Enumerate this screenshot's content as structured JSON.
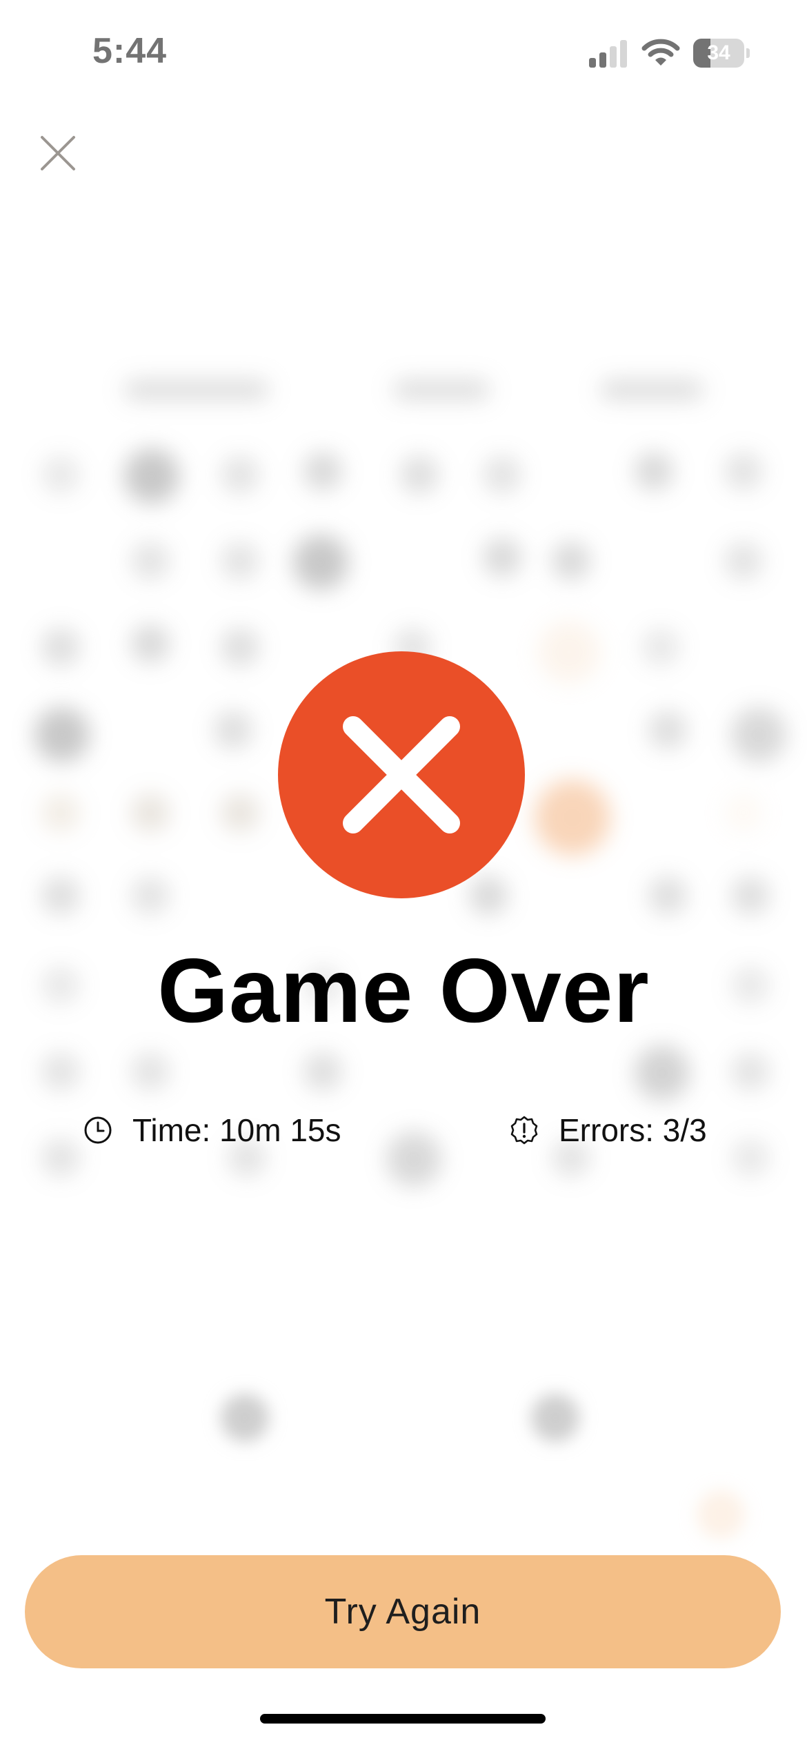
{
  "status_bar": {
    "time": "5:44",
    "battery": "34",
    "battery_level": 0.34
  },
  "game_over": {
    "title": "Game Over",
    "time_label": "Time: 10m 15s",
    "errors_label": "Errors: 3/3"
  },
  "actions": {
    "try_again": "Try Again"
  },
  "colors": {
    "accent_red": "#ea4f28",
    "button_orange": "#f4bf87",
    "highlight_orange": "#f2a66a"
  },
  "icons": {
    "close": "close-icon",
    "result": "x-mark-icon",
    "time": "clock-icon",
    "errors": "alert-badge-icon"
  }
}
